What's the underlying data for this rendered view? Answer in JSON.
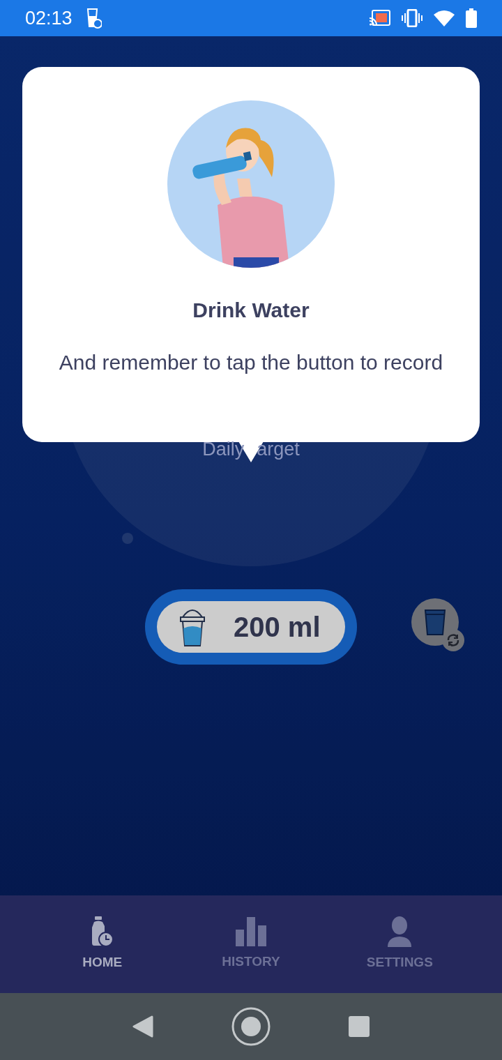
{
  "status_bar": {
    "time": "02:13"
  },
  "background": {
    "daily_target_visible_parts": [
      "Daily",
      "arget"
    ]
  },
  "drink_button": {
    "amount": "200 ml"
  },
  "popup": {
    "title": "Drink Water",
    "message": "And remember to tap the button to record"
  },
  "bottom_nav": [
    {
      "kind": "home",
      "label": "HOME",
      "selected": true
    },
    {
      "kind": "history",
      "label": "HISTORY",
      "selected": false
    },
    {
      "kind": "settings",
      "label": "SETTINGS",
      "selected": false
    }
  ]
}
